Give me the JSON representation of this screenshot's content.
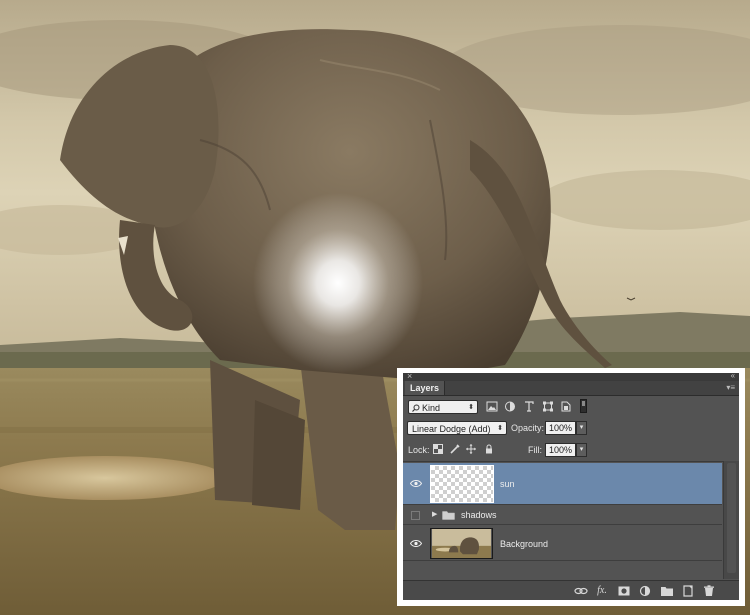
{
  "panel": {
    "tab_title": "Layers",
    "close_glyph": "×",
    "collapse_glyph": "‹‹",
    "menu_glyph": "▾≡"
  },
  "filter": {
    "kind_label": "Kind",
    "icons": [
      "image-filter-icon",
      "adjustment-filter-icon",
      "type-filter-icon",
      "shape-filter-icon",
      "smart-object-filter-icon"
    ]
  },
  "blend": {
    "mode": "Linear Dodge (Add)",
    "opacity_label": "Opacity:",
    "opacity_value": "100%"
  },
  "lock": {
    "label": "Lock:",
    "fill_label": "Fill:",
    "fill_value": "100%"
  },
  "layers": [
    {
      "name": "sun",
      "selected": true,
      "visible": true,
      "type": "pixel"
    },
    {
      "name": "shadows",
      "selected": false,
      "visible": false,
      "type": "group"
    },
    {
      "name": "Background",
      "selected": false,
      "visible": true,
      "type": "pixel"
    }
  ],
  "bottom_toolbar": {
    "fx_label": "fx.",
    "icons": [
      "link-layers-icon",
      "add-style-icon",
      "add-mask-icon",
      "new-adjustment-icon",
      "new-group-icon",
      "new-layer-icon",
      "delete-layer-icon"
    ]
  },
  "colors": {
    "panel_bg": "#535353",
    "selection": "#6b88ab",
    "frame": "#ffffff"
  }
}
